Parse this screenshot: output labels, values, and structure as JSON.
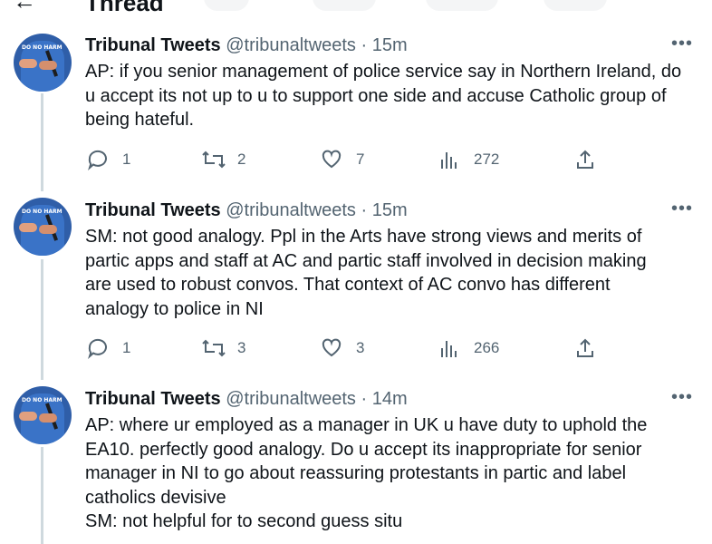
{
  "header": {
    "back_icon": "back-arrow-icon",
    "title": "Thread"
  },
  "tweets": [
    {
      "avatar_text": "DO NO HARM",
      "name": "Tribunal Tweets",
      "handle": "@tribunaltweets",
      "separator": "·",
      "time": "15m",
      "more_icon": "more-icon",
      "lines": [
        "AP: if you senior management of police service say in Northern Ireland, do",
        "u accept its not up to u to support one side and accuse Catholic group of",
        "being hateful."
      ],
      "actions": {
        "replies": "1",
        "retweets": "2",
        "likes": "7",
        "views": "272"
      }
    },
    {
      "avatar_text": "DO NO HARM",
      "name": "Tribunal Tweets",
      "handle": "@tribunaltweets",
      "separator": "·",
      "time": "15m",
      "more_icon": "more-icon",
      "lines": [
        "SM: not good analogy. Ppl in the Arts have strong views and merits of",
        "partic apps and staff at AC and partic staff involved in decision making",
        "are used to robust convos. That context of AC convo has different",
        "analogy to police in NI"
      ],
      "actions": {
        "replies": "1",
        "retweets": "3",
        "likes": "3",
        "views": "266"
      }
    },
    {
      "avatar_text": "DO NO HARM",
      "name": "Tribunal Tweets",
      "handle": "@tribunaltweets",
      "separator": "·",
      "time": "14m",
      "more_icon": "more-icon",
      "lines": [
        "AP: where ur employed as a manager in UK u have duty to uphold the",
        "EA10. perfectly good analogy. Do u accept its inappropriate for senior",
        "manager in NI to go about reassuring protestants in partic and label",
        "catholics devisive",
        "SM: not helpful for to second guess situ"
      ]
    }
  ],
  "icons": [
    "reply-icon",
    "retweet-icon",
    "like-icon",
    "views-icon",
    "share-icon"
  ]
}
